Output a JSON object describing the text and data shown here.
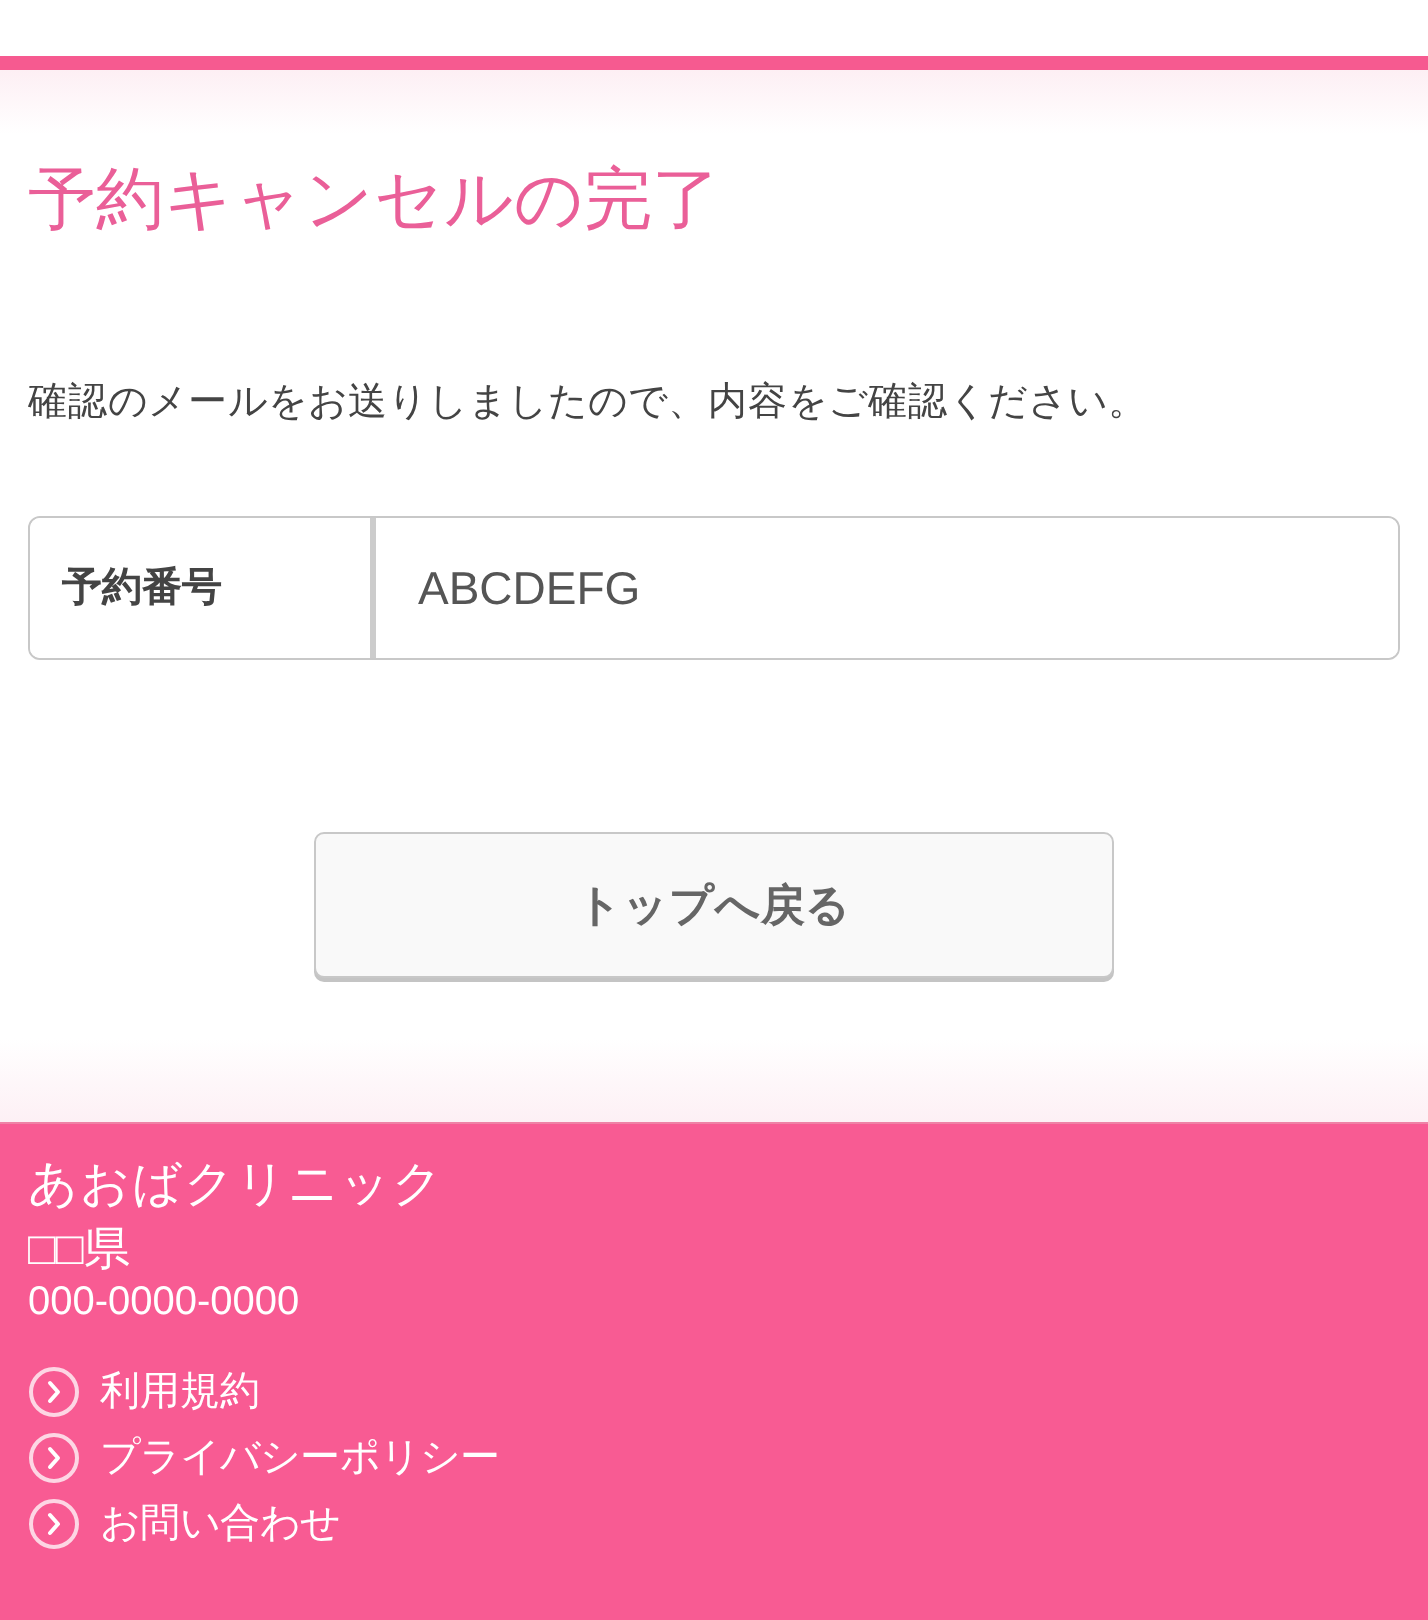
{
  "title": "予約キャンセルの完了",
  "message": "確認のメールをお送りしましたので、内容をご確認ください。",
  "reservation": {
    "label": "予約番号",
    "value": "ABCDEFG"
  },
  "buttons": [
    {
      "label": "トップへ戻る"
    }
  ],
  "footer": {
    "clinic_name": "あおばクリニック",
    "prefecture": "□□県",
    "phone": "000-0000-0000",
    "links": [
      {
        "label": "利用規約"
      },
      {
        "label": "プライバシーポリシー"
      },
      {
        "label": "お問い合わせ"
      }
    ]
  }
}
